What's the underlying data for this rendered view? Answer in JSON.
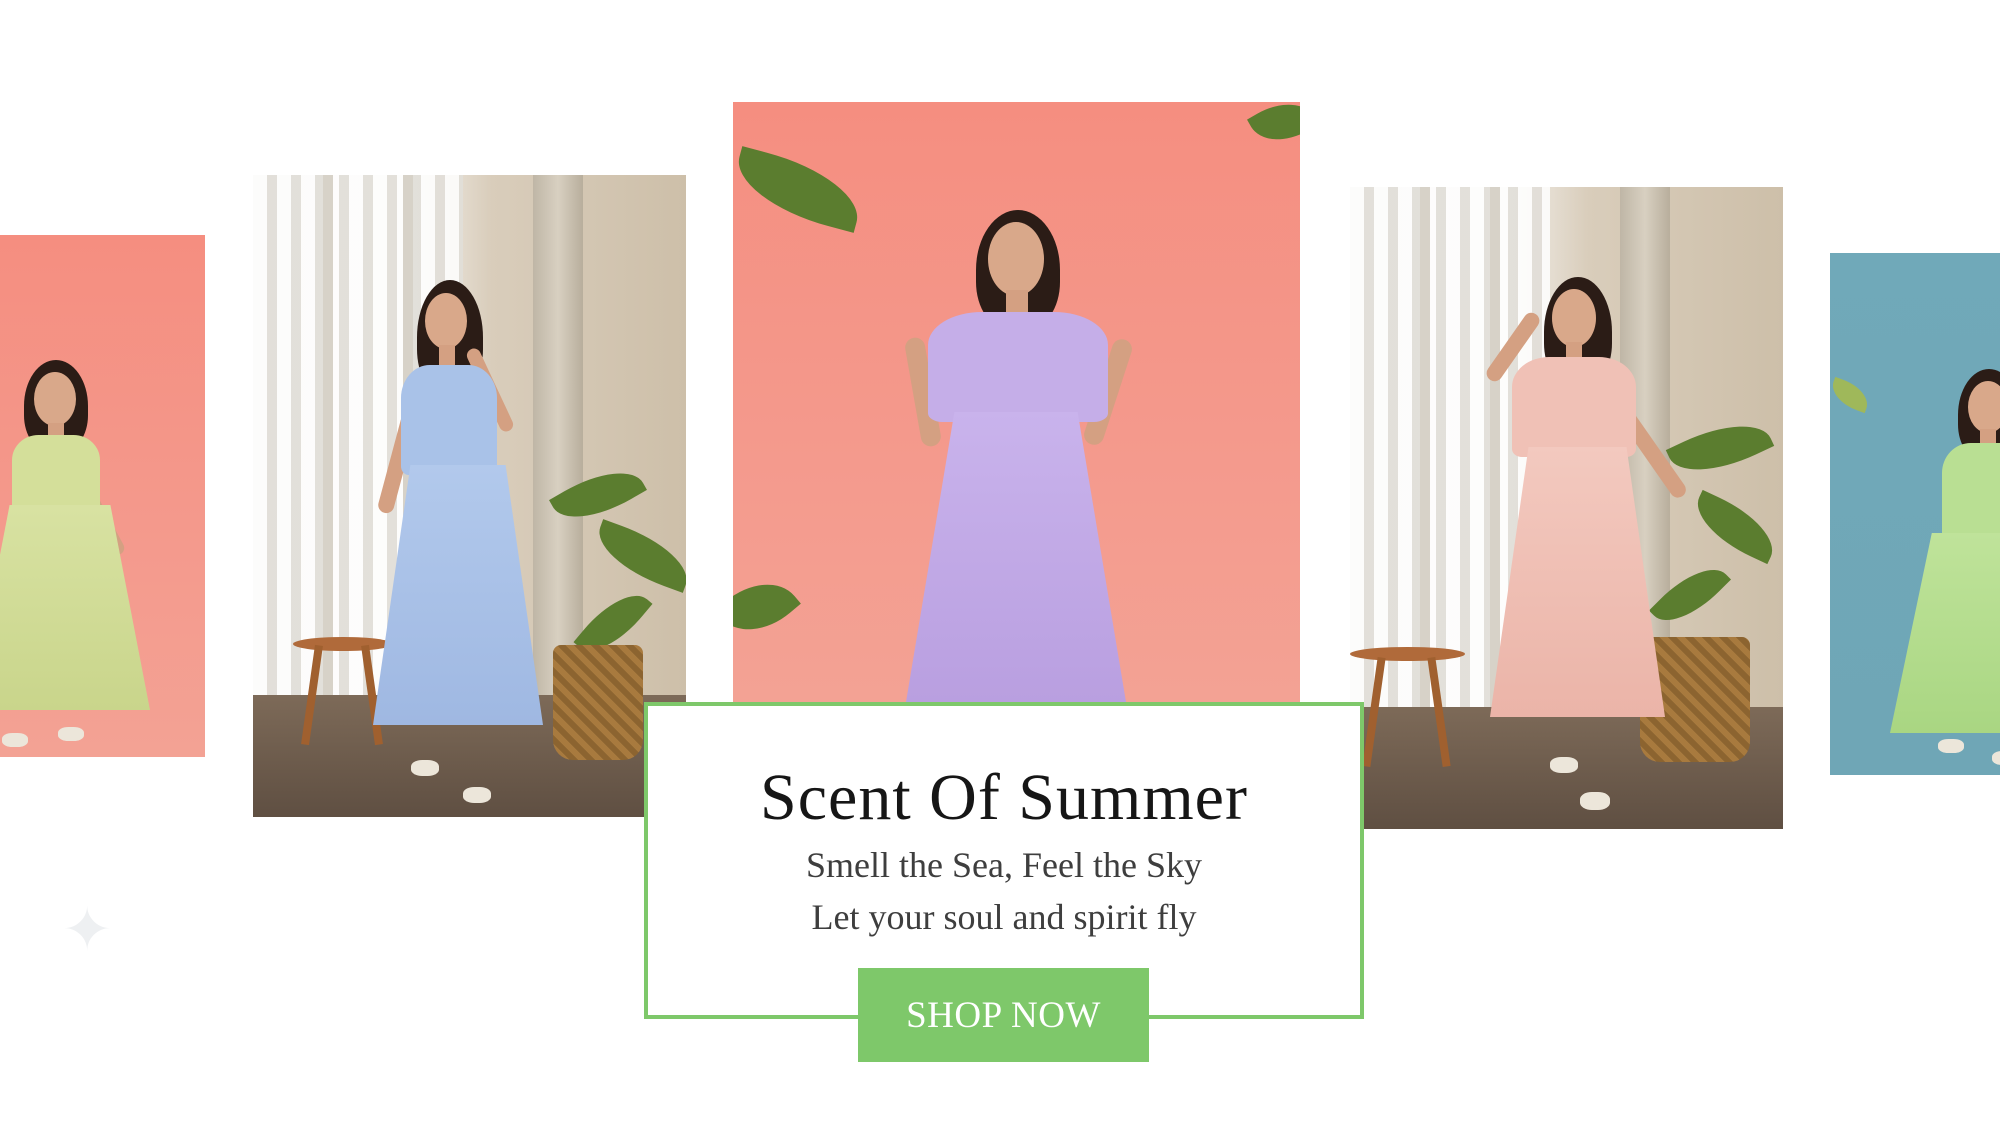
{
  "banner": {
    "title": "Scent Of Summer",
    "tagline_line1": "Smell the Sea, Feel the Sky",
    "tagline_line2": "Let your soul and spirit fly",
    "cta_label": "SHOP NOW"
  },
  "colors": {
    "accent_green": "#7ec86a",
    "pink_backdrop": "#f58e80",
    "teal_backdrop": "#70a9b9"
  },
  "slides": [
    {
      "dress_color": "#d4df9a",
      "backdrop": "pink"
    },
    {
      "dress_color": "#a9c2e8",
      "backdrop": "room"
    },
    {
      "dress_color": "#c5aee8",
      "backdrop": "pink"
    },
    {
      "dress_color": "#f0c1b6",
      "backdrop": "room"
    },
    {
      "dress_color": "#b9df93",
      "backdrop": "teal"
    }
  ],
  "icons": [
    "sparkle-icon"
  ]
}
